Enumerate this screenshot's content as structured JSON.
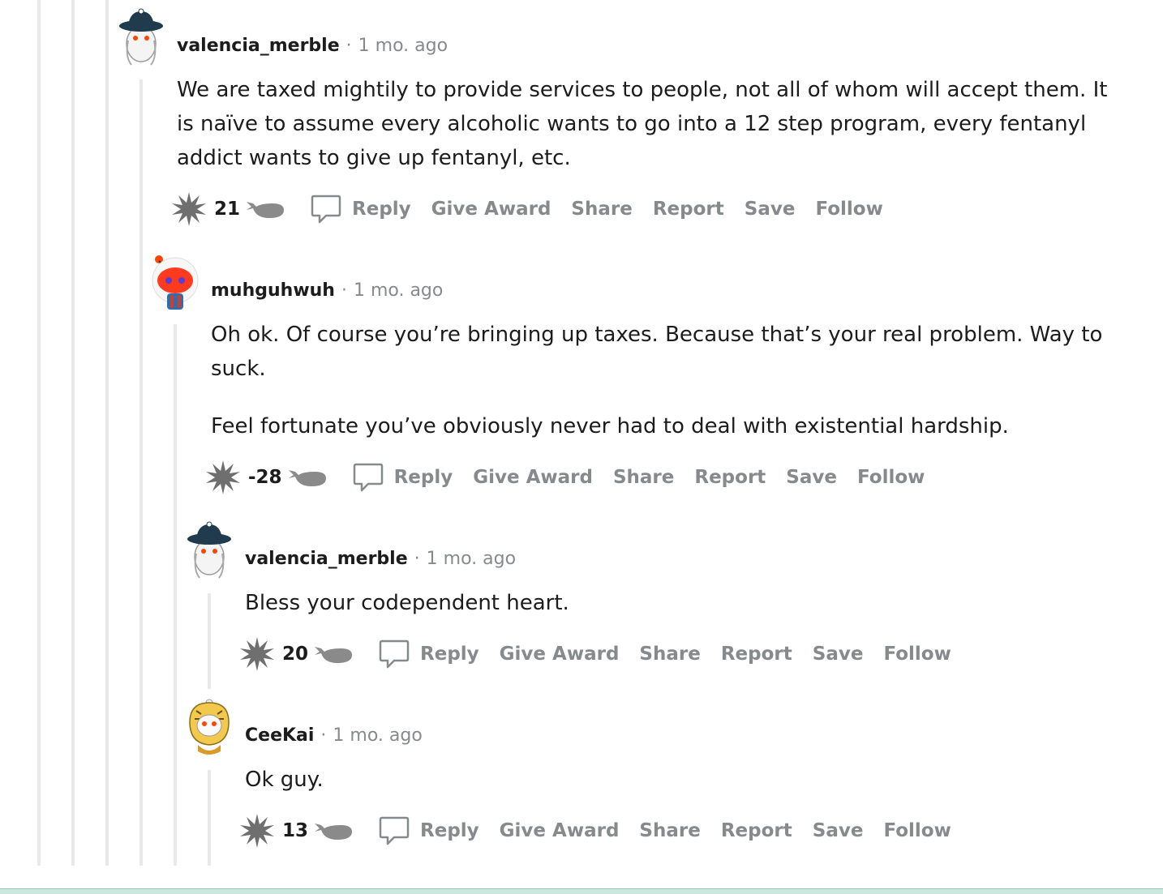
{
  "comments": [
    {
      "author": "valencia_merble",
      "time": "1 mo. ago",
      "body": [
        "We are taxed mightily to provide services to people, not all of whom will accept them. It is naïve to assume every alcoholic wants to go into a 12 step program, every fentanyl addict wants to give up fentanyl, etc."
      ],
      "score": "21",
      "avatar_icon": "girl-hat-avatar-icon"
    },
    {
      "author": "muhguhwuh",
      "time": "1 mo. ago",
      "body": [
        "Oh ok. Of course you’re bringing up taxes. Because that’s your real problem. Way to suck.",
        "Feel fortunate you’ve obviously never had to deal with existential hardship."
      ],
      "score": "-28",
      "avatar_icon": "snoo-red-avatar-icon"
    },
    {
      "author": "valencia_merble",
      "time": "1 mo. ago",
      "body": [
        "Bless your codependent heart."
      ],
      "score": "20",
      "avatar_icon": "girl-hat-avatar-icon"
    },
    {
      "author": "CeeKai",
      "time": "1 mo. ago",
      "body": [
        "Ok guy."
      ],
      "score": "13",
      "avatar_icon": "tiger-hood-avatar-icon"
    }
  ],
  "actions": {
    "reply": "Reply",
    "give_award": "Give Award",
    "share": "Share",
    "report": "Report",
    "save": "Save",
    "follow": "Follow"
  },
  "separator": "·",
  "colors": {
    "thread_line": "#e8e8e8",
    "meta_gray": "#878a8c",
    "text": "#1c1c1c",
    "upvote_gray": "#6f6f6f"
  }
}
